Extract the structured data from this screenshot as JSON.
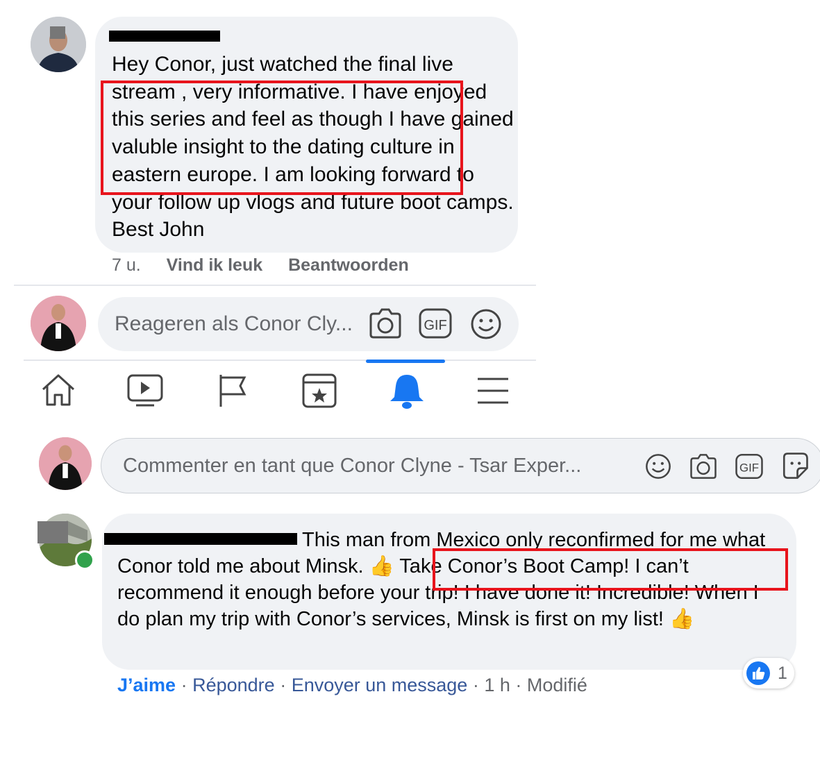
{
  "comment_top": {
    "text": "Hey Conor, just watched the  final live stream , very informative. I have enjoyed this series and feel as though I have gained valuble insight to the dating culture in eastern europe.  I am looking forward to your follow up vlogs and future boot camps. Best John",
    "time": "7 u.",
    "like": "Vind ik leuk",
    "reply": "Beantwoorden"
  },
  "reply_box_1": {
    "placeholder": "Reageren als Conor Cly..."
  },
  "reply_box_2": {
    "placeholder": "Commenter en tant que Conor Clyne - Tsar Exper..."
  },
  "comment_bottom": {
    "text": "This man from Mexico only reconfirmed for me what Conor told me about Minsk.  👍 Take Conor’s Boot Camp! I can’t recommend it enough before your trip! I have done it! Incredible! When I do plan my trip with Conor’s services, Minsk is first on my list! 👍",
    "like": "J’aime",
    "reply": "Répondre",
    "message": "Envoyer un message",
    "time": "1 h",
    "edited": "Modifié",
    "reaction_count": "1"
  },
  "icons": [
    "camera-icon",
    "gif-icon",
    "smiley-icon",
    "sticker-icon",
    "home-icon",
    "watch-icon",
    "flag-icon",
    "marketplace-icon",
    "bell-icon",
    "menu-icon",
    "thumbs-up-icon"
  ],
  "colors": {
    "accent": "#1877f2",
    "highlight": "#e8141c",
    "bubble": "#f0f2f5"
  }
}
